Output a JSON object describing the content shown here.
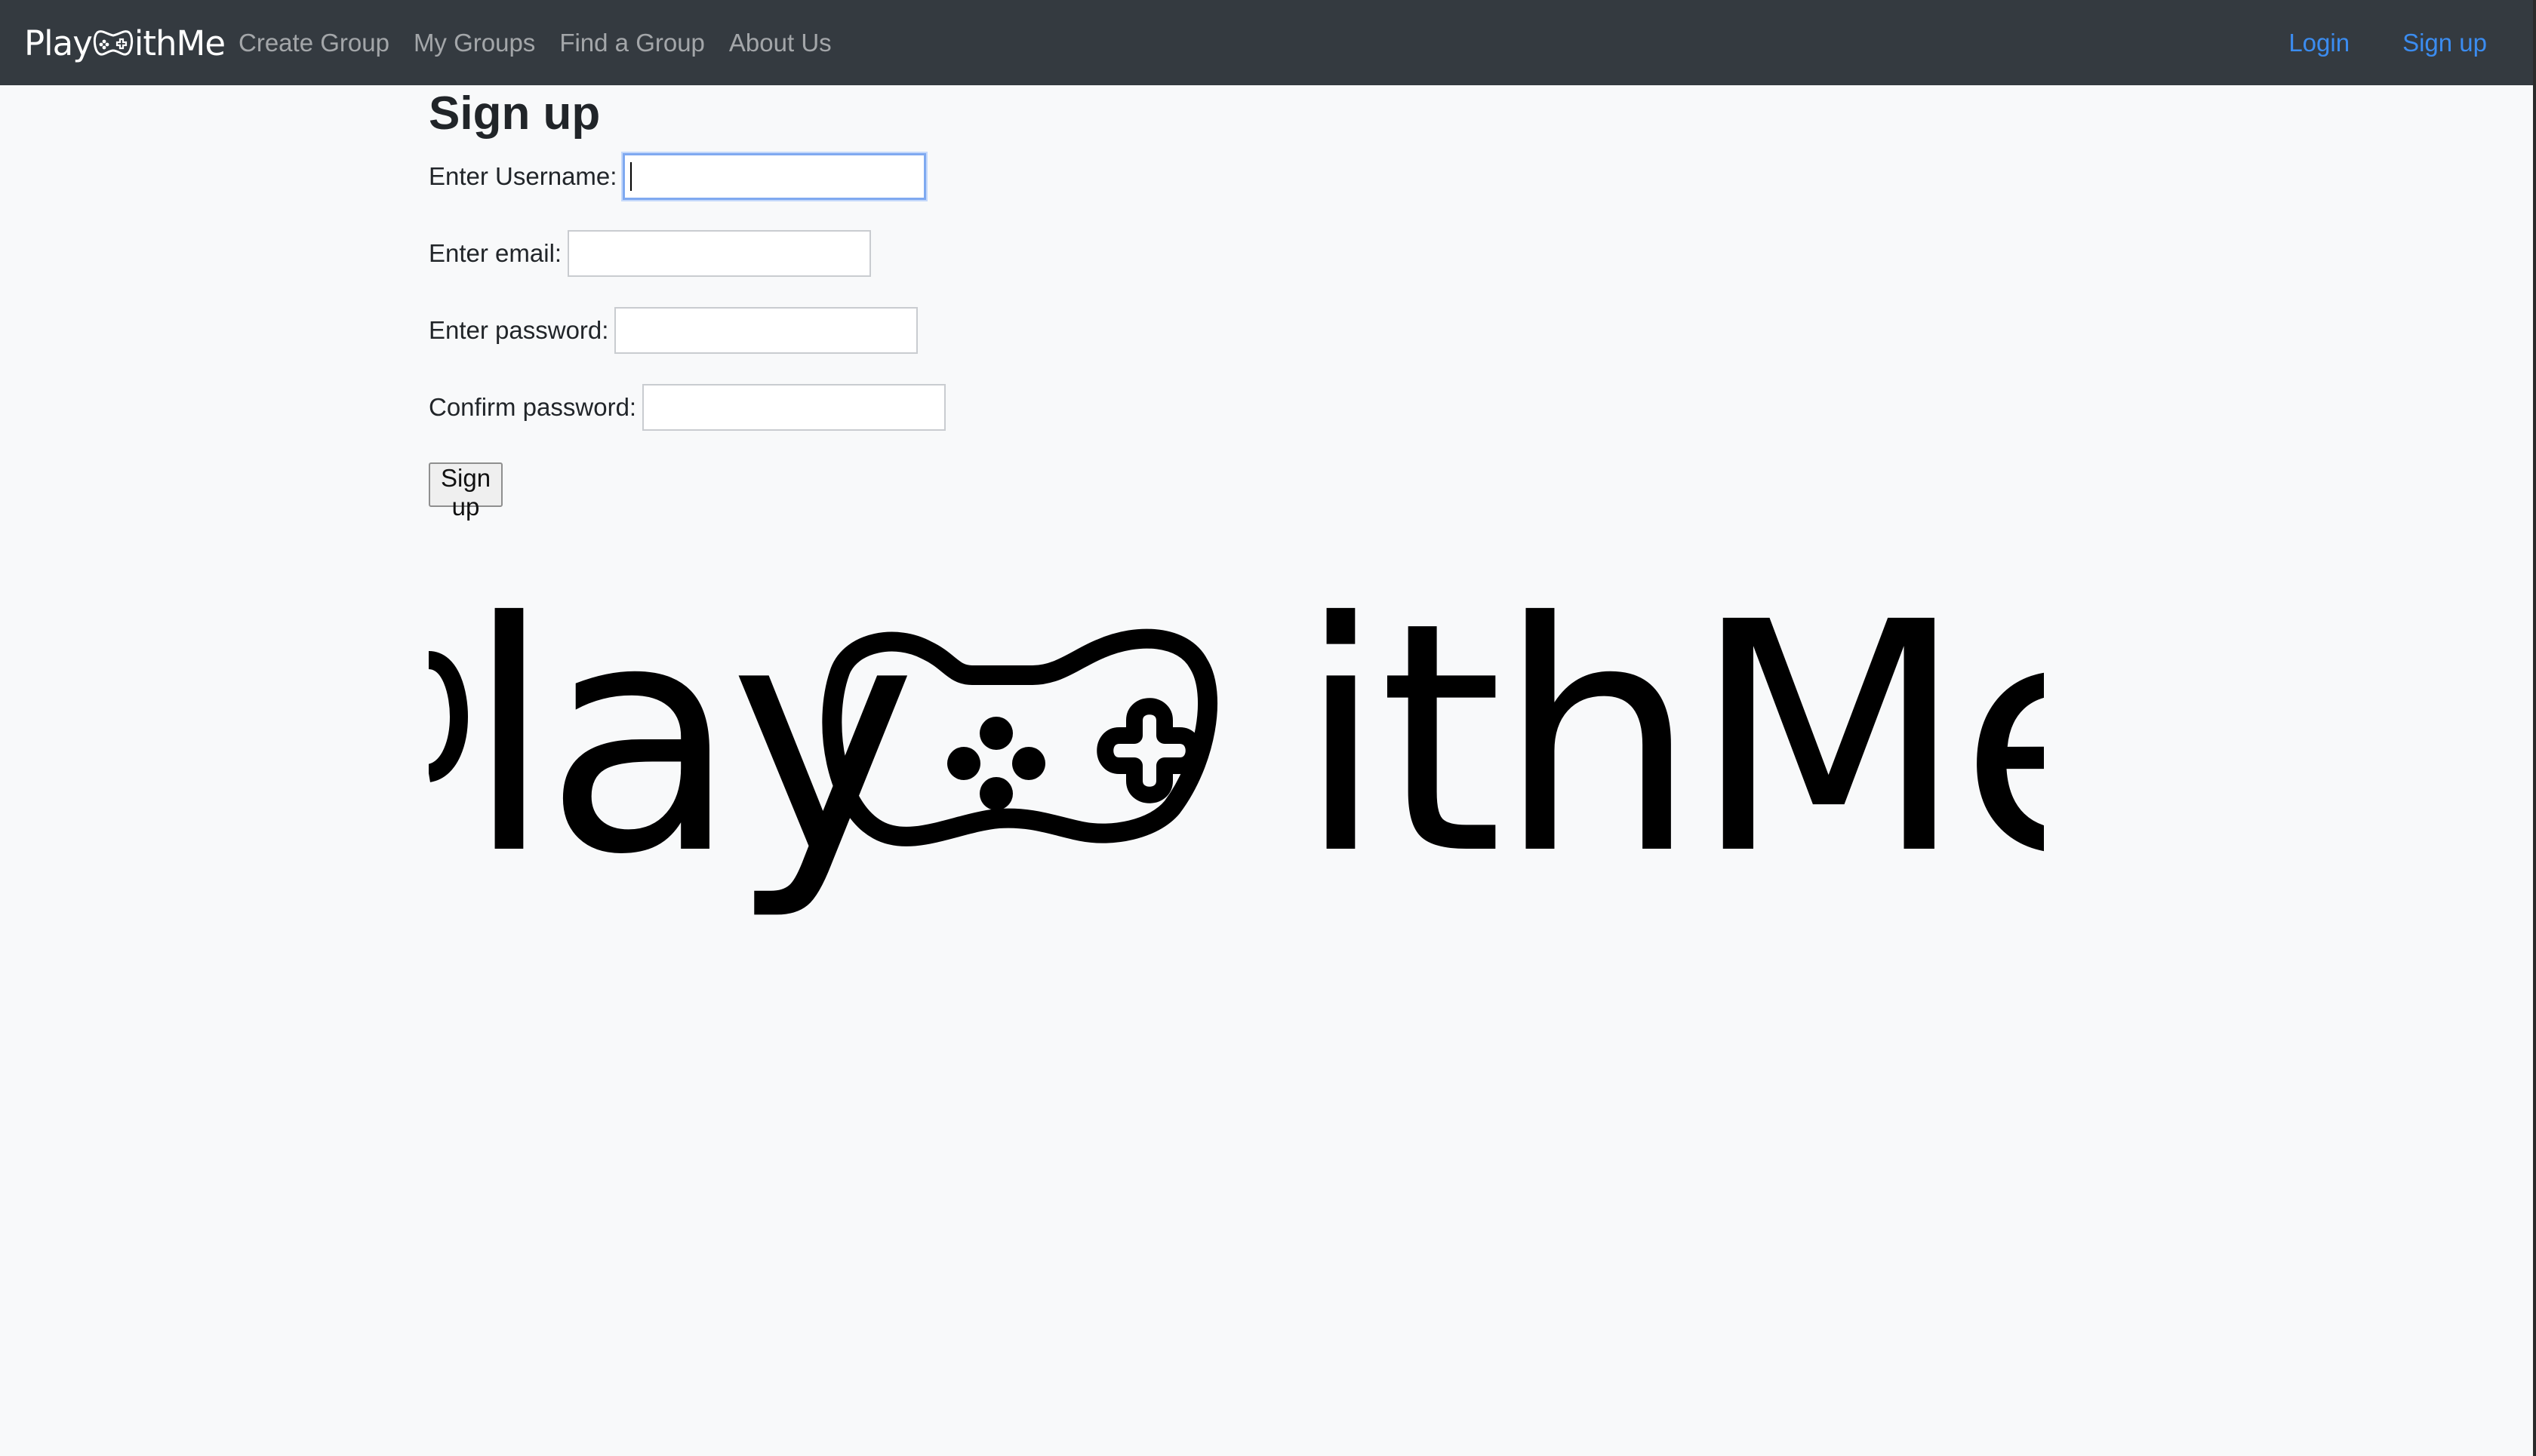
{
  "navbar": {
    "brand_left": "Play",
    "brand_right": "ithMe",
    "links": [
      "Create Group",
      "My Groups",
      "Find a Group",
      "About Us"
    ],
    "login_label": "Login",
    "signup_label": "Sign up"
  },
  "page": {
    "title": "Sign up"
  },
  "form": {
    "username_label": "Enter Username:",
    "username_value": "",
    "email_label": "Enter email:",
    "email_value": "",
    "password_label": "Enter password:",
    "password_value": "",
    "confirm_label": "Confirm password:",
    "confirm_value": "",
    "submit_label": "Sign up"
  },
  "logo": {
    "text_left": "lay",
    "text_right": "ithMe",
    "icon": "gamepad-icon"
  },
  "colors": {
    "navbar_bg": "#343a40",
    "page_bg": "#f8f9fa",
    "auth_link": "#3b8cf0",
    "focus_border": "#7fa9f0"
  }
}
